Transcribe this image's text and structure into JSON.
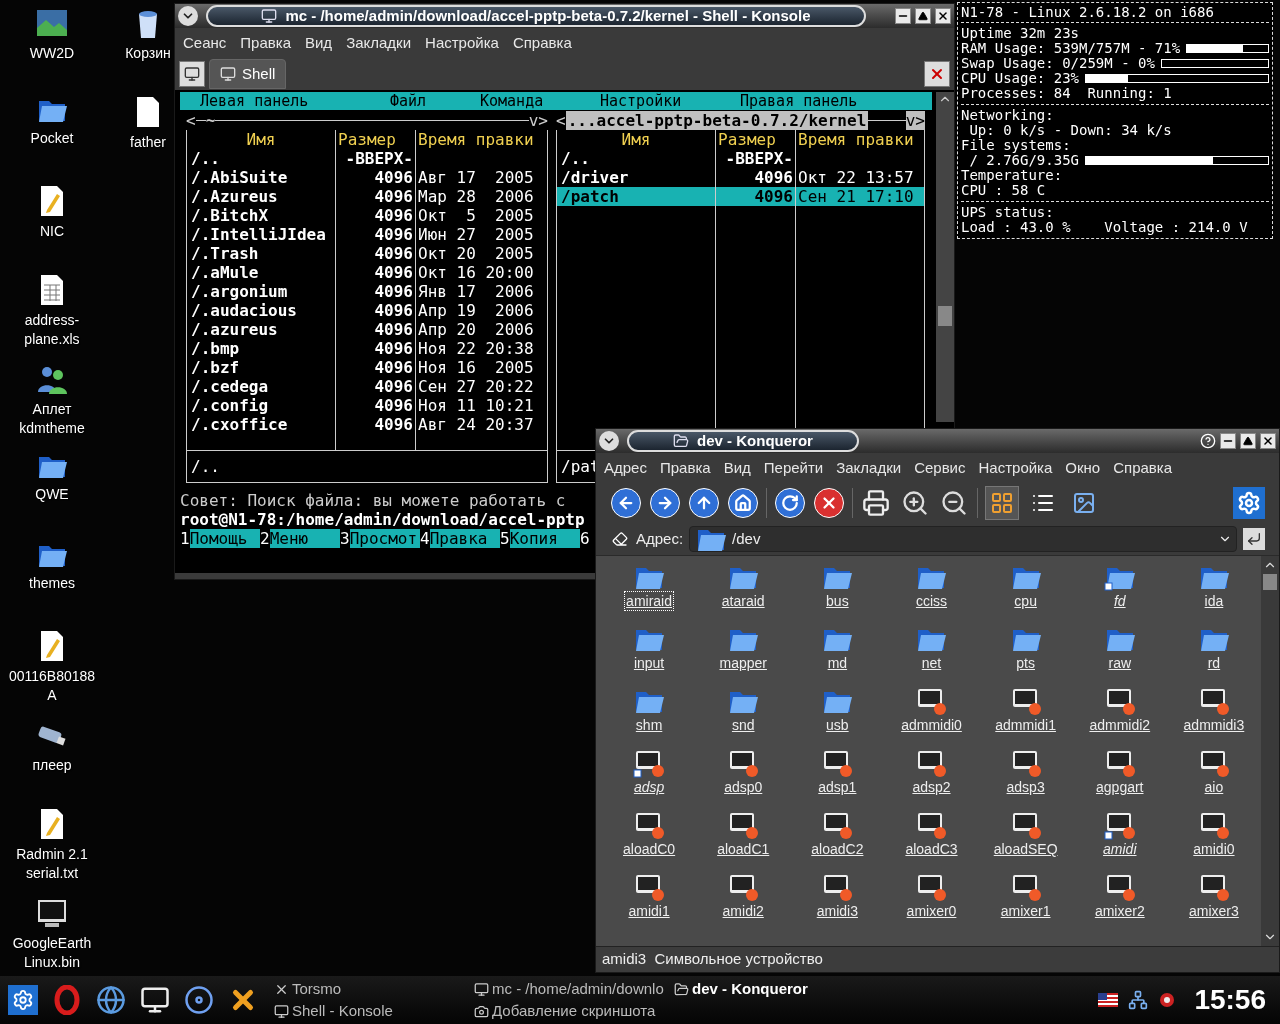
{
  "desktop_columns": [
    [
      {
        "label": "WW2D",
        "kind": "picture"
      },
      {
        "label": "Pocket",
        "kind": "folder"
      },
      {
        "label": "NIC",
        "kind": "text"
      },
      {
        "label": "address-plane.xls",
        "kind": "sheet"
      },
      {
        "label": "Аплет kdmtheme",
        "kind": "users"
      },
      {
        "label": "QWE",
        "kind": "folder"
      },
      {
        "label": "themes",
        "kind": "folder"
      },
      {
        "label": "00116B80188A",
        "kind": "text"
      },
      {
        "label": "плеер",
        "kind": "usb"
      },
      {
        "label": "Radmin 2.1 serial.txt",
        "kind": "text"
      },
      {
        "label": "GoogleEarth Linux.bin",
        "kind": "terminal"
      }
    ],
    [
      {
        "label": "Корзин",
        "kind": "trash"
      },
      {
        "label": "father",
        "kind": "document"
      }
    ]
  ],
  "konsole": {
    "title": "mc - /home/admin/download/accel-pptp-beta-0.7.2/kernel - Shell - Konsole",
    "menu": [
      "Сеанс",
      "Правка",
      "Вид",
      "Закладки",
      "Настройка",
      "Справка"
    ],
    "tabs": [
      {
        "label": "Shell",
        "selected": true
      }
    ],
    "mc": {
      "menu": [
        "Левая панель",
        "Файл",
        "Команда",
        "Настройки",
        "Правая панель"
      ],
      "panels": [
        {
          "left_mark": "<",
          "path": "~",
          "right_mark": "v>",
          "active": false,
          "columns": [
            "Имя",
            "Размер",
            "Время правки"
          ],
          "footer": "/..",
          "rows": [
            {
              "name": "/..",
              "size": "-ВВЕРХ-",
              "selected": false
            },
            {
              "name": "/.AbiSuite",
              "size": "4096",
              "date": "Авг 17  2005",
              "selected": false
            },
            {
              "name": "/.Azureus",
              "size": "4096",
              "date": "Мар 28  2006",
              "selected": false
            },
            {
              "name": "/.BitchX",
              "size": "4096",
              "date": "Окт  5  2005",
              "selected": false
            },
            {
              "name": "/.IntelliJIdea",
              "size": "4096",
              "date": "Июн 27  2005",
              "selected": false
            },
            {
              "name": "/.Trash",
              "size": "4096",
              "date": "Окт 20  2005",
              "selected": false
            },
            {
              "name": "/.aMule",
              "size": "4096",
              "date": "Окт 16 20:00",
              "selected": false
            },
            {
              "name": "/.argonium",
              "size": "4096",
              "date": "Янв 17  2006",
              "selected": false
            },
            {
              "name": "/.audacious",
              "size": "4096",
              "date": "Апр 19  2006",
              "selected": false
            },
            {
              "name": "/.azureus",
              "size": "4096",
              "date": "Апр 20  2006",
              "selected": false
            },
            {
              "name": "/.bmp",
              "size": "4096",
              "date": "Ноя 22 20:38",
              "selected": false
            },
            {
              "name": "/.bzf",
              "size": "4096",
              "date": "Ноя 16  2005",
              "selected": false
            },
            {
              "name": "/.cedega",
              "size": "4096",
              "date": "Сен 27 20:22",
              "selected": false
            },
            {
              "name": "/.config",
              "size": "4096",
              "date": "Ноя 11 10:21",
              "selected": false
            },
            {
              "name": "/.cxoffice",
              "size": "4096",
              "date": "Авг 24 20:37",
              "selected": false
            }
          ]
        },
        {
          "left_mark": "<",
          "path": "...accel-pptp-beta-0.7.2/kernel",
          "right_mark": "v>",
          "active": true,
          "columns": [
            "Имя",
            "Размер",
            "Время правки"
          ],
          "footer": "/pat",
          "rows": [
            {
              "name": "/..",
              "size": "-ВВЕРХ-",
              "selected": false
            },
            {
              "name": "/driver",
              "size": "4096",
              "date": "Окт 22 13:57",
              "selected": false
            },
            {
              "name": "/patch",
              "size": "4096",
              "date": "Сен 21 17:10",
              "selected": true
            }
          ]
        }
      ],
      "hint": "Совет: Поиск файла: вы можете работать с",
      "prompt": "root@N1-78:/home/admin/download/accel-pptp",
      "fkeys": [
        {
          "num": "1",
          "label": "Помощь"
        },
        {
          "num": "2",
          "label": "Меню"
        },
        {
          "num": "3",
          "label": "Просмот"
        },
        {
          "num": "4",
          "label": "Правка"
        },
        {
          "num": "5",
          "label": "Копия"
        },
        {
          "num": "6"
        }
      ]
    }
  },
  "conky": {
    "header": "N1-78 - Linux 2.6.18.2 on i686",
    "sections": [
      [
        {
          "kind": "text",
          "text": "Uptime 32m 23s"
        },
        {
          "kind": "bar",
          "text": "RAM Usage: 539M/757M - 71%",
          "level": 0.69
        },
        {
          "kind": "bar",
          "text": "Swap Usage: 0/259M - 0%",
          "level": 0
        },
        {
          "kind": "bar",
          "text": "CPU Usage: 23%",
          "level": 0.23
        },
        {
          "kind": "text",
          "text": "Processes: 84  Running: 1"
        }
      ],
      [
        {
          "kind": "text",
          "text": "Networking:"
        },
        {
          "kind": "text",
          "text": " Up: 0 k/s - Down: 34 k/s"
        },
        {
          "kind": "text",
          "text": "File systems:"
        },
        {
          "kind": "bar",
          "text": " / 2.76G/9.35G",
          "level": 0.7
        },
        {
          "kind": "text",
          "text": "Temperature:"
        },
        {
          "kind": "text",
          "text": "CPU : 58 C"
        }
      ],
      [
        {
          "kind": "text",
          "text": "UPS status:"
        },
        {
          "kind": "text",
          "text": "Load : 43.0 %    Voltage : 214.0 V"
        }
      ]
    ]
  },
  "konqueror": {
    "title": "dev - Konqueror",
    "menu": [
      "Адрес",
      "Правка",
      "Вид",
      "Перейти",
      "Закладки",
      "Сервис",
      "Настройка",
      "Окно",
      "Справка"
    ],
    "location": {
      "label": "Адрес:",
      "value": "/dev"
    },
    "items": [
      {
        "name": "amiraid",
        "kind": "folder",
        "link": false,
        "selected": true
      },
      {
        "name": "ataraid",
        "kind": "folder",
        "link": false,
        "selected": false
      },
      {
        "name": "bus",
        "kind": "folder",
        "link": false,
        "selected": false
      },
      {
        "name": "cciss",
        "kind": "folder",
        "link": false,
        "selected": false
      },
      {
        "name": "cpu",
        "kind": "folder",
        "link": false,
        "selected": false
      },
      {
        "name": "fd",
        "kind": "folder",
        "link": true,
        "selected": false
      },
      {
        "name": "ida",
        "kind": "folder",
        "link": false,
        "selected": false
      },
      {
        "name": "input",
        "kind": "folder",
        "link": false,
        "selected": false
      },
      {
        "name": "mapper",
        "kind": "folder",
        "link": false,
        "selected": false
      },
      {
        "name": "md",
        "kind": "folder",
        "link": false,
        "selected": false
      },
      {
        "name": "net",
        "kind": "folder",
        "link": false,
        "selected": false
      },
      {
        "name": "pts",
        "kind": "folder",
        "link": false,
        "selected": false
      },
      {
        "name": "raw",
        "kind": "folder",
        "link": false,
        "selected": false
      },
      {
        "name": "rd",
        "kind": "folder",
        "link": false,
        "selected": false
      },
      {
        "name": "shm",
        "kind": "folder",
        "link": false,
        "selected": false
      },
      {
        "name": "snd",
        "kind": "folder",
        "link": false,
        "selected": false
      },
      {
        "name": "usb",
        "kind": "folder",
        "link": false,
        "selected": false
      },
      {
        "name": "admmidi0",
        "kind": "device",
        "link": false,
        "selected": false
      },
      {
        "name": "admmidi1",
        "kind": "device",
        "link": false,
        "selected": false
      },
      {
        "name": "admmidi2",
        "kind": "device",
        "link": false,
        "selected": false
      },
      {
        "name": "admmidi3",
        "kind": "device",
        "link": false,
        "selected": false
      },
      {
        "name": "adsp",
        "kind": "device",
        "link": true,
        "selected": false
      },
      {
        "name": "adsp0",
        "kind": "device",
        "link": false,
        "selected": false
      },
      {
        "name": "adsp1",
        "kind": "device",
        "link": false,
        "selected": false
      },
      {
        "name": "adsp2",
        "kind": "device",
        "link": false,
        "selected": false
      },
      {
        "name": "adsp3",
        "kind": "device",
        "link": false,
        "selected": false
      },
      {
        "name": "agpgart",
        "kind": "device",
        "link": false,
        "selected": false
      },
      {
        "name": "aio",
        "kind": "device",
        "link": false,
        "selected": false
      },
      {
        "name": "aloadC0",
        "kind": "device",
        "link": false,
        "selected": false
      },
      {
        "name": "aloadC1",
        "kind": "device",
        "link": false,
        "selected": false
      },
      {
        "name": "aloadC2",
        "kind": "device",
        "link": false,
        "selected": false
      },
      {
        "name": "aloadC3",
        "kind": "device",
        "link": false,
        "selected": false
      },
      {
        "name": "aloadSEQ",
        "kind": "device",
        "link": false,
        "selected": false
      },
      {
        "name": "amidi",
        "kind": "device",
        "link": true,
        "selected": false
      },
      {
        "name": "amidi0",
        "kind": "device",
        "link": false,
        "selected": false
      },
      {
        "name": "amidi1",
        "kind": "device",
        "link": false,
        "selected": false
      },
      {
        "name": "amidi2",
        "kind": "device",
        "link": false,
        "selected": false
      },
      {
        "name": "amidi3",
        "kind": "device",
        "link": false,
        "selected": false
      },
      {
        "name": "amixer0",
        "kind": "device",
        "link": false,
        "selected": false
      },
      {
        "name": "amixer1",
        "kind": "device",
        "link": false,
        "selected": false
      },
      {
        "name": "amixer2",
        "kind": "device",
        "link": false,
        "selected": false
      },
      {
        "name": "amixer3",
        "kind": "device",
        "link": false,
        "selected": false
      }
    ],
    "status": "amidi3  Символьное устройство"
  },
  "taskbar": {
    "launchers": [
      {
        "kind": "gear"
      },
      {
        "kind": "ring"
      },
      {
        "kind": "globe"
      },
      {
        "kind": "terminal"
      },
      {
        "kind": "disc"
      },
      {
        "kind": "cross"
      }
    ],
    "tasks": [
      {
        "label": "Torsmo",
        "kind": "cross",
        "selected": false
      },
      {
        "label": "Shell - Konsole",
        "kind": "terminal",
        "selected": false
      },
      {
        "label": "mc - /home/admin/downlo",
        "kind": "terminal",
        "selected": false
      },
      {
        "label": "Добавление скриншота",
        "kind": "camera",
        "selected": false
      },
      {
        "label": "dev - Konqueror",
        "kind": "folder",
        "selected": true
      }
    ],
    "clock": "15:56"
  }
}
